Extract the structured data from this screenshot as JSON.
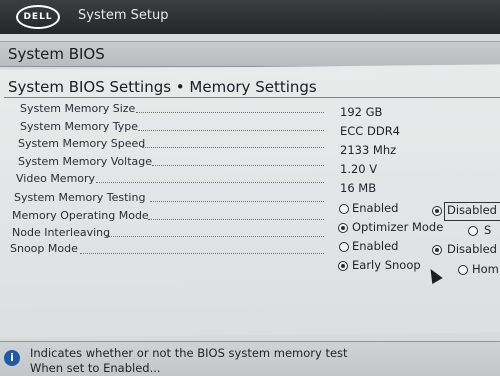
{
  "header": {
    "logo_text": "DELL",
    "app_title": "System Setup"
  },
  "bios_title": "System BIOS",
  "section_title": "System BIOS Settings • Memory Settings",
  "rows": {
    "system_memory_size": {
      "label": "System Memory Size",
      "value": "192 GB"
    },
    "system_memory_type": {
      "label": "System Memory Type",
      "value": "ECC DDR4"
    },
    "system_memory_speed": {
      "label": "System Memory Speed",
      "value": "2133 Mhz"
    },
    "system_memory_voltage": {
      "label": "System Memory Voltage",
      "value": "1.20 V"
    },
    "video_memory": {
      "label": "Video Memory",
      "value": "16 MB"
    },
    "system_memory_testing": {
      "label": "System Memory Testing",
      "options": [
        "Enabled",
        "Disabled"
      ],
      "selected": "Disabled"
    },
    "memory_operating_mode": {
      "label": "Memory Operating Mode",
      "options": [
        "Optimizer Mode",
        "S"
      ],
      "selected": "Optimizer Mode"
    },
    "node_interleaving": {
      "label": "Node Interleaving",
      "options": [
        "Enabled",
        "Disabled"
      ],
      "selected": "Disabled"
    },
    "snoop_mode": {
      "label": "Snoop Mode",
      "options": [
        "Early Snoop",
        "Hom"
      ],
      "selected": "Early Snoop"
    }
  },
  "help": {
    "line1": "Indicates whether or not the BIOS system memory test",
    "line2": "When set to Enabled..."
  },
  "icons": {
    "info": "info-icon",
    "cursor": "mouse-pointer-icon"
  }
}
